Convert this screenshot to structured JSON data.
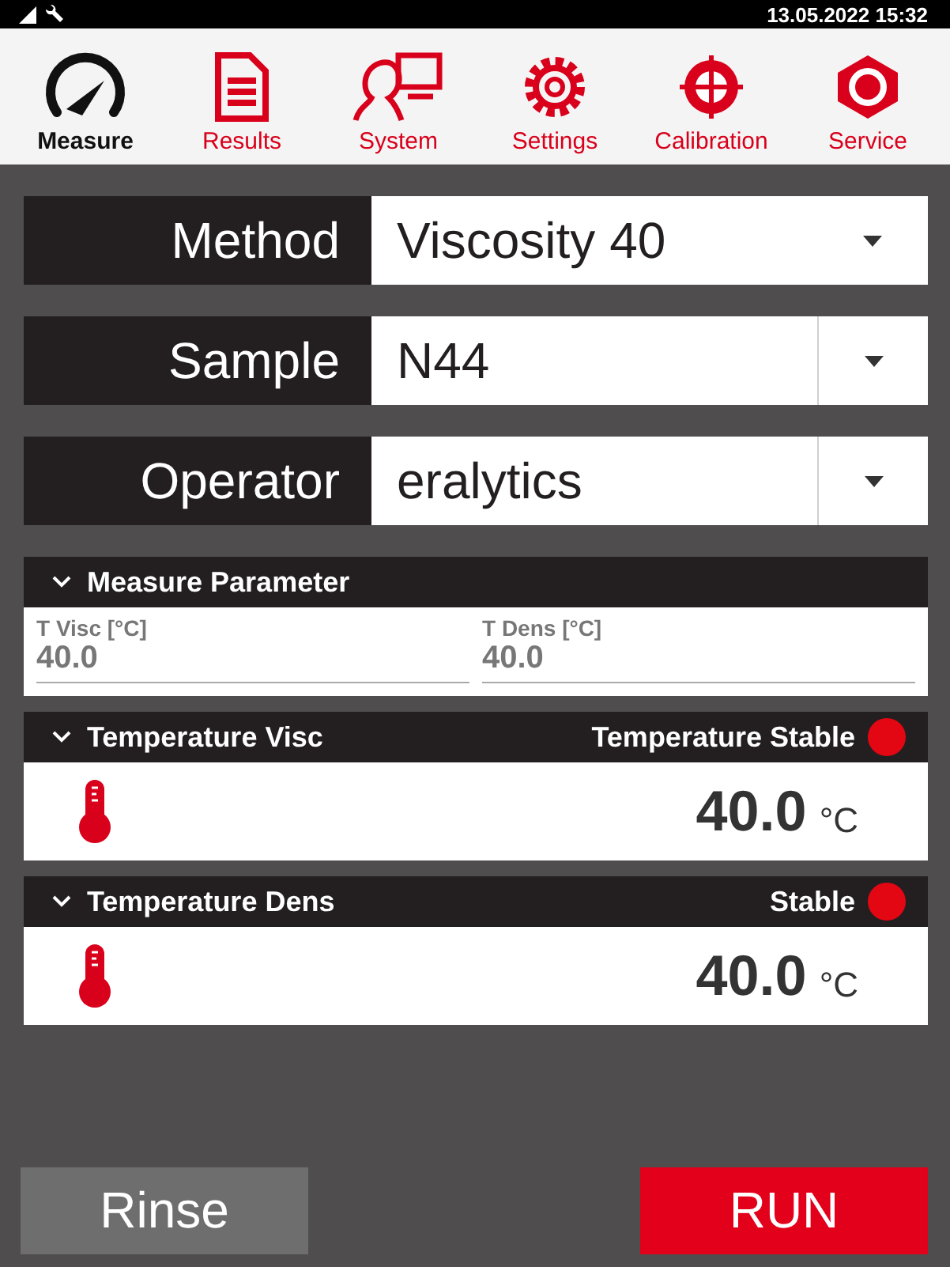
{
  "status_bar": {
    "datetime": "13.05.2022 15:32"
  },
  "tabs": [
    {
      "label": "Measure",
      "selected": true
    },
    {
      "label": "Results",
      "selected": false
    },
    {
      "label": "System",
      "selected": false
    },
    {
      "label": "Settings",
      "selected": false
    },
    {
      "label": "Calibration",
      "selected": false
    },
    {
      "label": "Service",
      "selected": false
    }
  ],
  "selectors": [
    {
      "label": "Method",
      "value": "Viscosity 40",
      "kind": "dropdown"
    },
    {
      "label": "Sample",
      "value": "N44",
      "kind": "combo"
    },
    {
      "label": "Operator",
      "value": "eralytics",
      "kind": "combo"
    }
  ],
  "measure_parameter": {
    "title": "Measure Parameter",
    "expanded": true,
    "fields": [
      {
        "label": "T Visc [°C]",
        "value": "40.0"
      },
      {
        "label": "T Dens [°C]",
        "value": "40.0"
      }
    ]
  },
  "temperatures": [
    {
      "title": "Temperature Visc",
      "status": "Temperature Stable",
      "color": "#e30613",
      "value": "40.0",
      "unit": "°C",
      "expanded": true
    },
    {
      "title": "Temperature Dens",
      "status": "Stable",
      "color": "#e30613",
      "value": "40.0",
      "unit": "°C",
      "expanded": true
    }
  ],
  "buttons": [
    {
      "label": "Rinse",
      "kind": "secondary"
    },
    {
      "label": "RUN",
      "kind": "primary"
    }
  ]
}
